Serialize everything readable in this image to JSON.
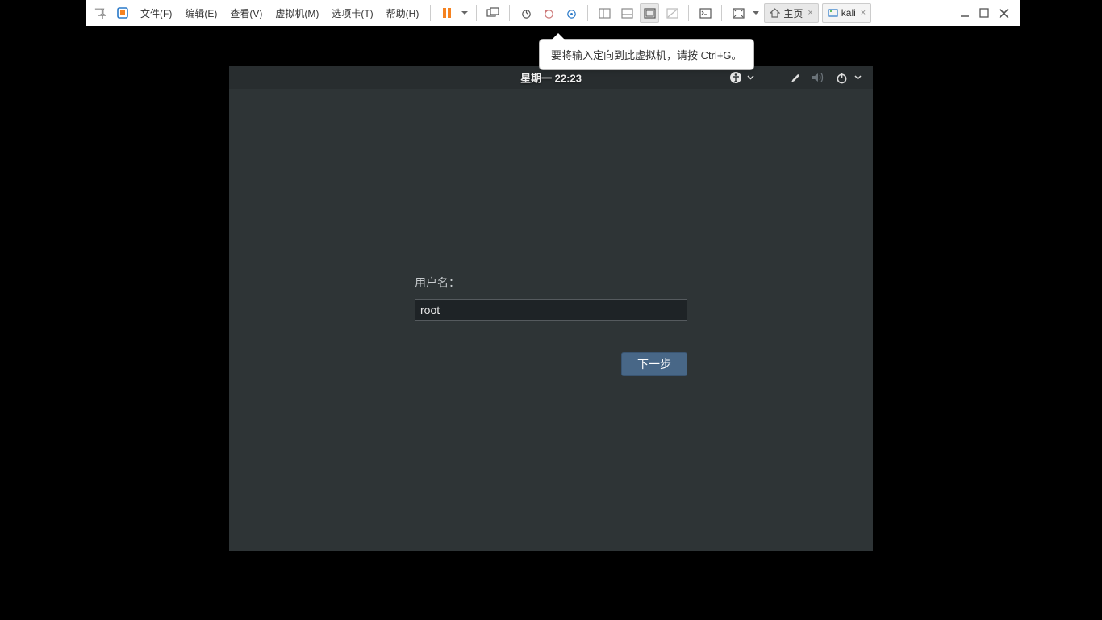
{
  "toolbar": {
    "menus": {
      "file": "文件(F)",
      "edit": "编辑(E)",
      "view": "查看(V)",
      "vm": "虚拟机(M)",
      "tabs": "选项卡(T)",
      "help": "帮助(H)"
    },
    "tabs": {
      "home": "主页",
      "kali": "kali"
    }
  },
  "tooltip": {
    "text": "要将输入定向到此虚拟机，请按 Ctrl+G。"
  },
  "guest": {
    "clock": "星期一 22:23",
    "login": {
      "username_label": "用户名：",
      "username_value": "root",
      "next_button": "下一步"
    }
  }
}
